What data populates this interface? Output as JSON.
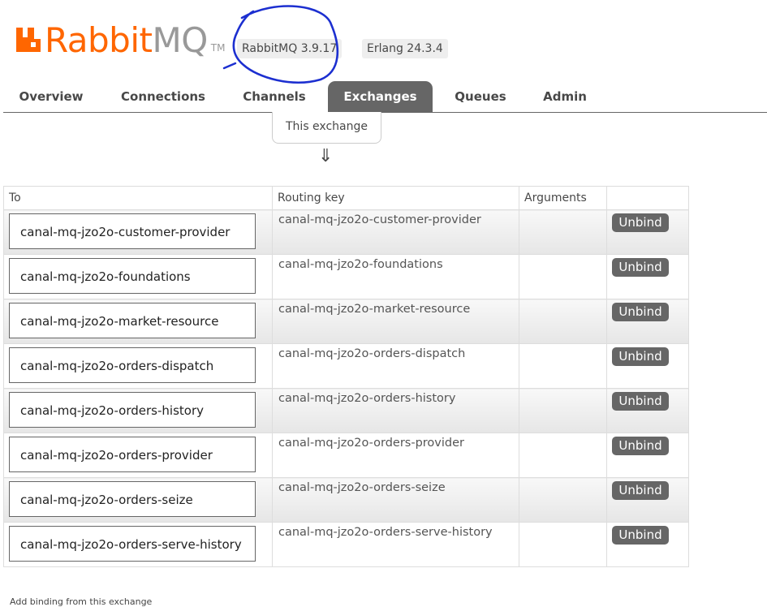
{
  "header": {
    "logo_rabbit": "Rabbit",
    "logo_mq": "MQ",
    "logo_tm": "TM",
    "rabbitmq_version": "RabbitMQ 3.9.17",
    "erlang_version": "Erlang 24.3.4",
    "brand_color": "#ff6600"
  },
  "nav": {
    "tabs": [
      {
        "label": "Overview"
      },
      {
        "label": "Connections"
      },
      {
        "label": "Channels"
      },
      {
        "label": "Exchanges",
        "active": true
      },
      {
        "label": "Queues"
      },
      {
        "label": "Admin"
      }
    ]
  },
  "exchange": {
    "this_exchange": "This exchange",
    "arrow": "⇓"
  },
  "bindings": {
    "headers": [
      "To",
      "Routing key",
      "Arguments",
      ""
    ],
    "unbind_label": "Unbind",
    "rows": [
      {
        "to": "canal-mq-jzo2o-customer-provider",
        "routing_key": "canal-mq-jzo2o-customer-provider",
        "arguments": ""
      },
      {
        "to": "canal-mq-jzo2o-foundations",
        "routing_key": "canal-mq-jzo2o-foundations",
        "arguments": ""
      },
      {
        "to": "canal-mq-jzo2o-market-resource",
        "routing_key": "canal-mq-jzo2o-market-resource",
        "arguments": ""
      },
      {
        "to": "canal-mq-jzo2o-orders-dispatch",
        "routing_key": "canal-mq-jzo2o-orders-dispatch",
        "arguments": ""
      },
      {
        "to": "canal-mq-jzo2o-orders-history",
        "routing_key": "canal-mq-jzo2o-orders-history",
        "arguments": ""
      },
      {
        "to": "canal-mq-jzo2o-orders-provider",
        "routing_key": "canal-mq-jzo2o-orders-provider",
        "arguments": ""
      },
      {
        "to": "canal-mq-jzo2o-orders-seize",
        "routing_key": "canal-mq-jzo2o-orders-seize",
        "arguments": ""
      },
      {
        "to": "canal-mq-jzo2o-orders-serve-history",
        "routing_key": "canal-mq-jzo2o-orders-serve-history",
        "arguments": ""
      }
    ]
  },
  "footer": {
    "text": "Add binding from this exchange"
  }
}
